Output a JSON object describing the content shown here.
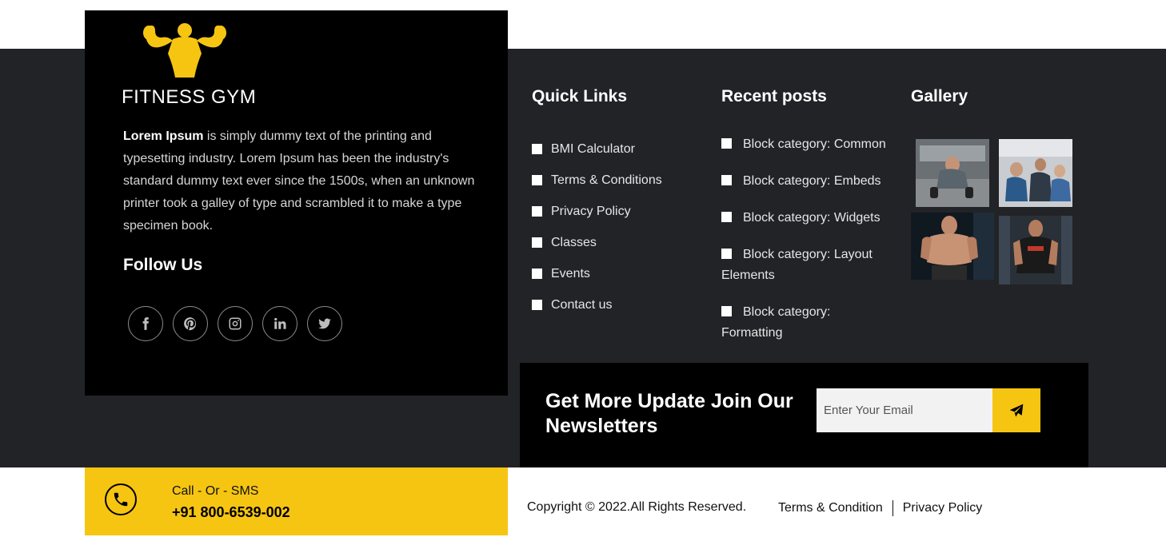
{
  "brand": {
    "name": "FITNESS GYM",
    "about_bold": "Lorem Ipsum",
    "about_rest": " is simply dummy text of the printing and typesetting industry. Lorem Ipsum has been the industry's standard dummy text ever since the 1500s, when an unknown printer took a galley of type and scrambled it to make a type specimen book.",
    "follow_title": "Follow Us",
    "socials": [
      "facebook-icon",
      "pinterest-icon",
      "instagram-icon",
      "linkedin-icon",
      "twitter-icon"
    ]
  },
  "quick_links": {
    "title": "Quick Links",
    "items": [
      "BMI Calculator",
      "Terms & Conditions",
      "Privacy Policy",
      "Classes",
      "Events",
      "Contact us"
    ]
  },
  "recent_posts": {
    "title": "Recent posts",
    "items": [
      "Block category: Common",
      "Block category: Embeds",
      "Block category: Widgets",
      "Block category: Layout Elements",
      "Block category: Formatting"
    ]
  },
  "gallery": {
    "title": "Gallery"
  },
  "newsletter": {
    "title": "Get More Update Join Our Newsletters",
    "placeholder": "Enter Your Email",
    "button_icon": "send-icon"
  },
  "contact": {
    "label": "Call - Or - SMS",
    "number": "+91 800-6539-002"
  },
  "bottom": {
    "copyright": "Copyright © 2022.All Rights Reserved.",
    "terms": "Terms & Condition",
    "privacy": "Privacy Policy"
  },
  "colors": {
    "accent": "#f6c512",
    "footer_bg": "#222327",
    "panel_bg": "#000000"
  }
}
